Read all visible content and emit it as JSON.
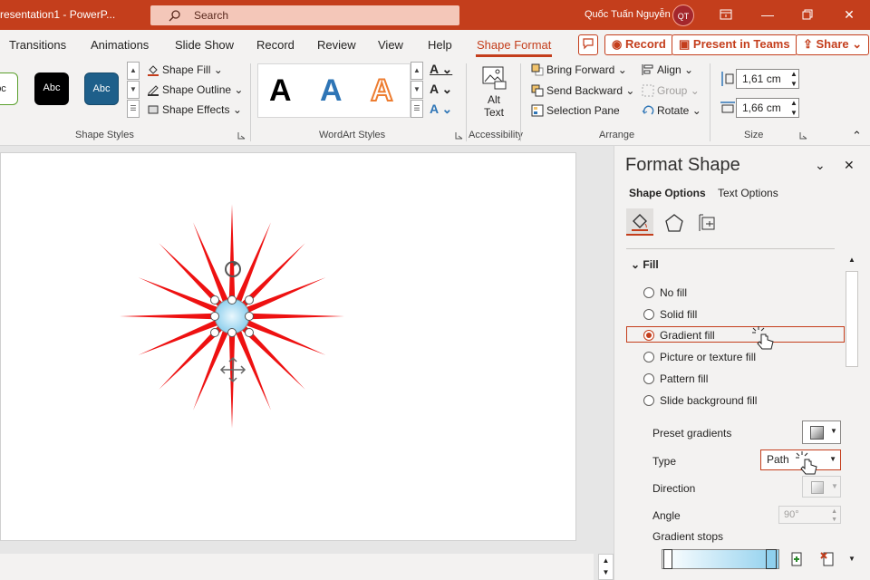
{
  "titlebar": {
    "doc_title": "resentation1  -  PowerP...",
    "search_placeholder": "Search",
    "user_name": "Quốc Tuấn Nguyễn",
    "user_initials": "QT"
  },
  "tabs": [
    "Transitions",
    "Animations",
    "Slide Show",
    "Record",
    "Review",
    "View",
    "Help",
    "Shape Format"
  ],
  "top_buttons": {
    "record": "Record",
    "present": "Present in Teams",
    "share": "Share"
  },
  "ribbon": {
    "shape_styles": {
      "samples": [
        "bc",
        "Abc",
        "Abc"
      ],
      "fill": "Shape Fill",
      "outline": "Shape Outline",
      "effects": "Shape Effects",
      "group_label": "Shape Styles"
    },
    "wordart": {
      "letters": [
        "A",
        "A",
        "A"
      ],
      "group_label": "WordArt Styles"
    },
    "accessibility": {
      "alt_text_line1": "Alt",
      "alt_text_line2": "Text",
      "group_label": "Accessibility"
    },
    "arrange": {
      "bring_forward": "Bring Forward",
      "send_backward": "Send Backward",
      "selection_pane": "Selection Pane",
      "align": "Align",
      "group": "Group",
      "rotate": "Rotate",
      "group_label": "Arrange"
    },
    "size": {
      "height": "1,61 cm",
      "width": "1,66 cm",
      "group_label": "Size"
    }
  },
  "pane": {
    "title": "Format Shape",
    "tab_shape": "Shape Options",
    "tab_text": "Text Options",
    "section": "Fill",
    "fill_options": [
      {
        "label": "No fill",
        "selected": false
      },
      {
        "label": "Solid fill",
        "selected": false
      },
      {
        "label": "Gradient fill",
        "selected": true
      },
      {
        "label": "Picture or texture fill",
        "selected": false
      },
      {
        "label": "Pattern fill",
        "selected": false
      },
      {
        "label": "Slide background fill",
        "selected": false
      }
    ],
    "preset_gradients": "Preset gradients",
    "type_label": "Type",
    "type_value": "Path",
    "direction_label": "Direction",
    "angle_label": "Angle",
    "angle_value": "90°",
    "gradient_stops": "Gradient stops"
  },
  "colors": {
    "accent": "#c43e1c",
    "star": "#ee1111",
    "center": "#8fd0ee"
  }
}
